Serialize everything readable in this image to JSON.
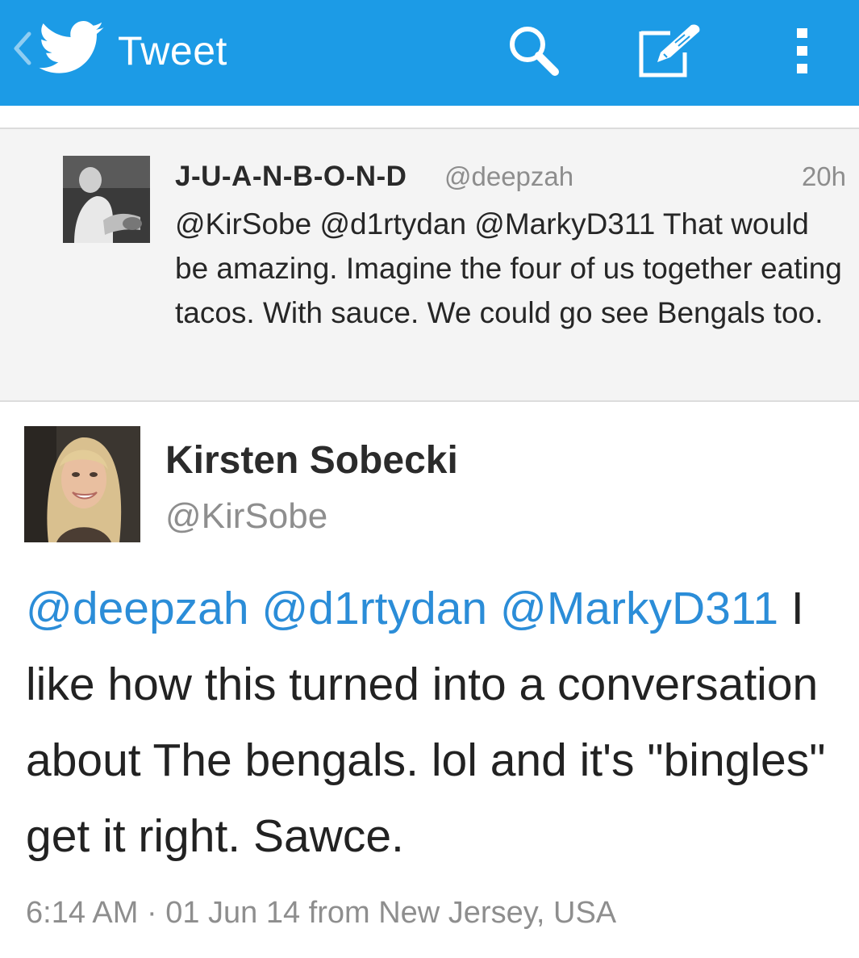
{
  "actionbar": {
    "title": "Tweet",
    "background_color": "#1c9be6",
    "icons": [
      "chevron-left-icon",
      "twitter-bird-icon",
      "search-icon",
      "compose-icon",
      "overflow-menu-icon"
    ]
  },
  "parent_tweet": {
    "name": "J-U-A-N-B-O-N-D",
    "handle": "@deepzah",
    "time": "20h",
    "text": "@KirSobe @d1rtydan @MarkyD311 That would be amazing. Imagine the four of us together eating tacos. With sauce. We could go see Bengals too."
  },
  "main_tweet": {
    "name": "Kirsten Sobecki",
    "handle": "@KirSobe",
    "mentions": [
      "@deepzah",
      "@d1rtydan",
      "@MarkyD311"
    ],
    "body": " I like how this turned into a conversation about The bengals. lol and it's \"bingles\" get it right. Sawce.",
    "meta": "6:14 AM · 01 Jun 14 from New Jersey, USA",
    "mention_color": "#2b8dd8"
  }
}
